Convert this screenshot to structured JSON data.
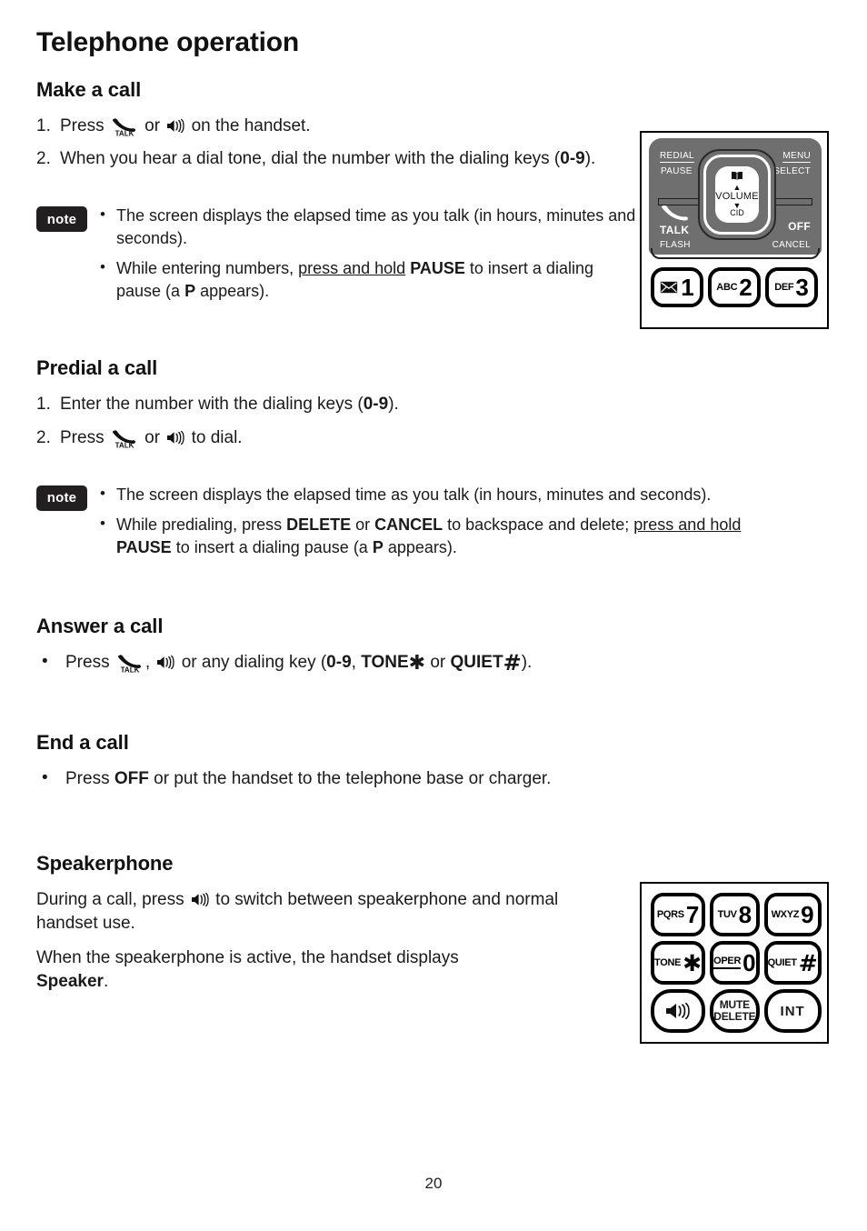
{
  "page": {
    "title": "Telephone operation",
    "number": "20"
  },
  "sections": {
    "make_a_call": {
      "heading": "Make a call",
      "steps": [
        {
          "num": "1.",
          "pre": "Press ",
          "mid": " or ",
          "post": " on the handset."
        },
        {
          "num": "2.",
          "text_a": "When you hear a dial tone, dial the number with the dialing keys (",
          "bold": "0-9",
          "text_b": ")."
        }
      ],
      "note_label": "note",
      "notes": [
        {
          "text_a": "The screen displays the elapsed time as you talk (in hours, minutes and seconds)."
        },
        {
          "text_a": "While entering numbers, ",
          "underline": "press and hold",
          "bold_a": "PAUSE",
          "text_b": " to insert a dialing pause (a ",
          "bold_b": "P",
          "text_c": " appears)."
        }
      ]
    },
    "predial_a_call": {
      "heading": "Predial a call",
      "steps": [
        {
          "num": "1.",
          "text_a": "Enter the number with the dialing keys (",
          "bold": "0-9",
          "text_b": ")."
        },
        {
          "num": "2.",
          "pre": "Press ",
          "mid": " or ",
          "post": " to dial."
        }
      ],
      "note_label": "note",
      "notes": [
        {
          "text_a": "The screen displays the elapsed time as you talk (in hours, minutes and seconds)."
        },
        {
          "text_a": "While predialing, press ",
          "bold_a": "DELETE",
          "text_b": " or ",
          "bold_b": "CANCEL",
          "text_c": " to backspace and delete; ",
          "underline": "press and hold",
          "bold_c": "PAUSE",
          "text_d": " to insert a dialing pause (a ",
          "bold_d": "P",
          "text_e": " appears)."
        }
      ]
    },
    "answer_a_call": {
      "heading": "Answer a call",
      "bullet": {
        "pre": "Press ",
        "mid": ", ",
        "post": " or any dialing key (",
        "bold_a": "0-9",
        "sep": ", ",
        "bold_tone": "TONE",
        "star": "✱",
        "or": " or ",
        "bold_quiet": "QUIET",
        "hash": "#",
        "end": ")."
      }
    },
    "end_a_call": {
      "heading": "End a call",
      "bullet": {
        "text_a": "Press ",
        "bold": "OFF",
        "text_b": " or put the handset to the telephone base or charger."
      }
    },
    "speakerphone": {
      "heading": "Speakerphone",
      "para1": {
        "pre": "During a call, press ",
        "post": " to switch between speakerphone and normal handset use."
      },
      "para2": {
        "text_a": "When the speakerphone is active, the handset displays ",
        "bold": "Speaker",
        "text_b": "."
      }
    }
  },
  "diagram_top": {
    "labels": {
      "redial": "REDIAL",
      "pause": "PAUSE",
      "menu": "MENU",
      "select": "SELECT",
      "talk": "TALK",
      "flash": "FLASH",
      "off": "OFF",
      "cancel": "CANCEL",
      "volume": "VOLUME",
      "cid": "CID",
      "up_arrow": "▲",
      "down_arrow": "▼"
    },
    "keys": [
      {
        "letters": "",
        "digit": "1",
        "icon": "envelope-icon"
      },
      {
        "letters": "ABC",
        "digit": "2",
        "icon": ""
      },
      {
        "letters": "DEF",
        "digit": "3",
        "icon": ""
      }
    ]
  },
  "diagram_bottom": {
    "keys": [
      {
        "letters": "PQRS",
        "digit": "7",
        "type": "digit"
      },
      {
        "letters": "TUV",
        "digit": "8",
        "type": "digit"
      },
      {
        "letters": "WXYZ",
        "digit": "9",
        "type": "digit"
      },
      {
        "letters": "TONE",
        "digit": "✱",
        "type": "symbol"
      },
      {
        "letters": "OPER",
        "digit": "0",
        "type": "digit-underline"
      },
      {
        "letters": "QUIET",
        "digit": "#",
        "type": "symbol"
      },
      {
        "letters": "",
        "digit": "",
        "type": "speaker-icon"
      },
      {
        "line1": "MUTE",
        "line2": "DELETE",
        "type": "two-line"
      },
      {
        "text": "INT",
        "type": "text"
      }
    ]
  },
  "colors": {
    "ink": "#1a1a1a",
    "note_badge_bg": "#221f20",
    "nav_panel_grey": "#6f6f6f",
    "white": "#ffffff"
  }
}
